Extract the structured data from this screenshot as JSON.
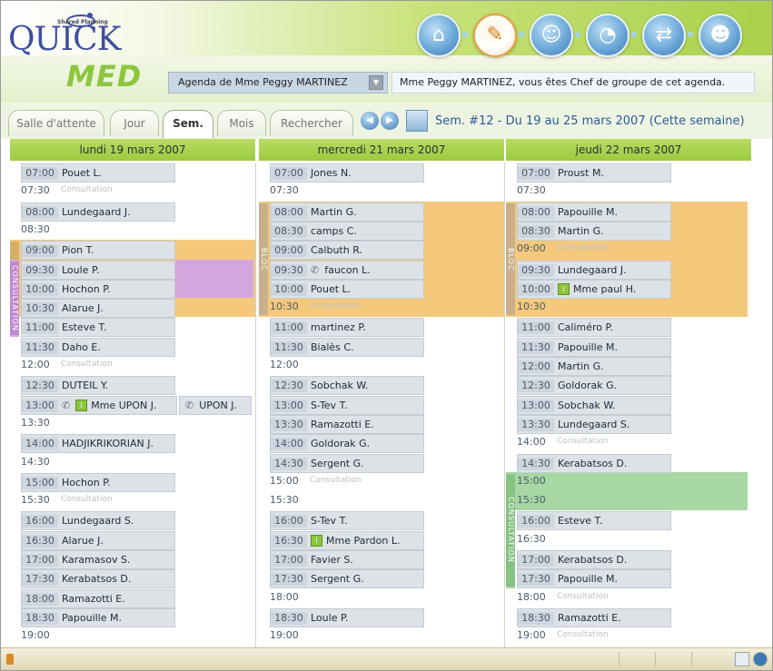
{
  "app": {
    "logo_small": "Shared Planning",
    "logo_quick": "QUICK",
    "logo_med": "MED"
  },
  "header": {
    "agenda_label": "Agenda de Mme Peggy MARTINEZ",
    "chef_message": "Mme Peggy MARTINEZ, vous êtes Chef de groupe de cet agenda."
  },
  "nav_icons": [
    "home-icon",
    "clipboard-icon",
    "group-icon",
    "clock-icon",
    "handshake-icon",
    "doctor-icon"
  ],
  "tabs": [
    {
      "label": "Salle d'attente",
      "active": false
    },
    {
      "label": "Jour",
      "active": false
    },
    {
      "label": "Sem.",
      "active": true
    },
    {
      "label": "Mois",
      "active": false
    },
    {
      "label": "Rechercher",
      "active": false
    }
  ],
  "week_label": "Sem. #12 - Du 19 au 25 mars 2007 (Cette semaine)",
  "colors": {
    "header_green": "#9ccb3e",
    "bloc_orange": "#f5c97c",
    "purple": "#d6a7de",
    "green_block": "#a7d7a3",
    "appt_bg": "#dde2e7"
  },
  "days": [
    {
      "title": "lundi 19 mars 2007",
      "bands": [
        {
          "label": "BLOC",
          "from": 4,
          "to": 8,
          "color": "#f5c97c",
          "labelcolor": "#d4b067"
        },
        {
          "label": "CONSULTATION",
          "from": 5,
          "to": 9,
          "color": "#d6a7de",
          "labelcolor": "#c08ad0",
          "short": true
        }
      ],
      "slots": [
        {
          "t": "07:00",
          "n": "Pouet L."
        },
        {
          "t": "07:30",
          "c": "Consultation"
        },
        {
          "t": "08:00",
          "n": "Lundegaard J."
        },
        {
          "t": "08:30"
        },
        {
          "t": "09:00",
          "n": "Pion T."
        },
        {
          "t": "09:30",
          "n": "Loule P."
        },
        {
          "t": "10:00",
          "n": "Hochon P."
        },
        {
          "t": "10:30",
          "n": "Alarue J."
        },
        {
          "t": "11:00",
          "n": "Esteve T."
        },
        {
          "t": "11:30",
          "n": "Daho E."
        },
        {
          "t": "12:00",
          "c": "Consultation"
        },
        {
          "t": "12:30",
          "n": "DUTEIL Y."
        },
        {
          "t": "13:00",
          "n": "Mme UPON J.",
          "phone": true,
          "info": true,
          "extra": "UPON J."
        },
        {
          "t": "13:30"
        },
        {
          "t": "14:00",
          "n": "HADJIKRIKORIAN J."
        },
        {
          "t": "14:30"
        },
        {
          "t": "15:00",
          "n": "Hochon P."
        },
        {
          "t": "15:30",
          "c": "Consultation"
        },
        {
          "t": "16:00",
          "n": "Lundegaard S."
        },
        {
          "t": "16:30",
          "n": "Alarue J."
        },
        {
          "t": "17:00",
          "n": "Karamasov S."
        },
        {
          "t": "17:30",
          "n": "Kerabatsos D."
        },
        {
          "t": "18:00",
          "n": "Ramazotti E."
        },
        {
          "t": "18:30",
          "n": "Papouille M."
        },
        {
          "t": "19:00"
        }
      ]
    },
    {
      "title": "mercredi 21 mars 2007",
      "bands": [
        {
          "label": "BLOC",
          "from": 2,
          "to": 8,
          "color": "#f5c97c",
          "labelcolor": "#c7b08a"
        }
      ],
      "slots": [
        {
          "t": "07:00",
          "n": "Jones N."
        },
        {
          "t": "07:30"
        },
        {
          "t": "08:00",
          "n": "Martin G."
        },
        {
          "t": "08:30",
          "n": "camps C."
        },
        {
          "t": "09:00",
          "n": "Calbuth R."
        },
        {
          "t": "09:30",
          "n": "faucon L.",
          "phone": true
        },
        {
          "t": "10:00",
          "n": "Pouet L."
        },
        {
          "t": "10:30",
          "c": "Consultation"
        },
        {
          "t": "11:00",
          "n": "martinez P."
        },
        {
          "t": "11:30",
          "n": "Bialès C."
        },
        {
          "t": "12:00"
        },
        {
          "t": "12:30",
          "n": "Sobchak W."
        },
        {
          "t": "13:00",
          "n": "S-Tev T."
        },
        {
          "t": "13:30",
          "n": "Ramazotti E."
        },
        {
          "t": "14:00",
          "n": "Goldorak G."
        },
        {
          "t": "14:30",
          "n": "Sergent G."
        },
        {
          "t": "15:00",
          "c": "Consultation"
        },
        {
          "t": "15:30"
        },
        {
          "t": "16:00",
          "n": "S-Tev T."
        },
        {
          "t": "16:30",
          "n": "Mme Pardon L.",
          "info": true
        },
        {
          "t": "17:00",
          "n": "Favier S."
        },
        {
          "t": "17:30",
          "n": "Sergent G."
        },
        {
          "t": "18:00"
        },
        {
          "t": "18:30",
          "n": "Loule P."
        },
        {
          "t": "19:00"
        }
      ]
    },
    {
      "title": "jeudi 22 mars 2007",
      "bands": [
        {
          "label": "BLOC",
          "from": 2,
          "to": 8,
          "color": "#f5c97c",
          "labelcolor": "#c7b08a"
        },
        {
          "label": "CONSULTATION",
          "from": 16,
          "to": 22,
          "color": "#a7d7a3",
          "labelcolor": "#88c184",
          "short": true
        }
      ],
      "slots": [
        {
          "t": "07:00",
          "n": "Proust M."
        },
        {
          "t": "07:30"
        },
        {
          "t": "08:00",
          "n": "Papouille M."
        },
        {
          "t": "08:30",
          "n": "Martin G."
        },
        {
          "t": "09:00",
          "c": "Consultation"
        },
        {
          "t": "09:30",
          "n": "Lundegaard J."
        },
        {
          "t": "10:00",
          "n": "Mme paul H.",
          "info": true
        },
        {
          "t": "10:30"
        },
        {
          "t": "11:00",
          "n": "Caliméro P."
        },
        {
          "t": "11:30",
          "n": "Papouille M."
        },
        {
          "t": "12:00",
          "n": "Martin G."
        },
        {
          "t": "12:30",
          "n": "Goldorak G."
        },
        {
          "t": "13:00",
          "n": "Sobchak W."
        },
        {
          "t": "13:30",
          "n": "Lundegaard S."
        },
        {
          "t": "14:00",
          "c": "Consultation"
        },
        {
          "t": "14:30",
          "n": "Kerabatsos D."
        },
        {
          "t": "15:00"
        },
        {
          "t": "15:30"
        },
        {
          "t": "16:00",
          "n": "Esteve T."
        },
        {
          "t": "16:30"
        },
        {
          "t": "17:00",
          "n": "Kerabatsos D."
        },
        {
          "t": "17:30",
          "n": "Papouille M."
        },
        {
          "t": "18:00",
          "c": "Consultation"
        },
        {
          "t": "18:30",
          "n": "Ramazotti E."
        },
        {
          "t": "19:00",
          "c": "Consultation"
        }
      ]
    }
  ]
}
